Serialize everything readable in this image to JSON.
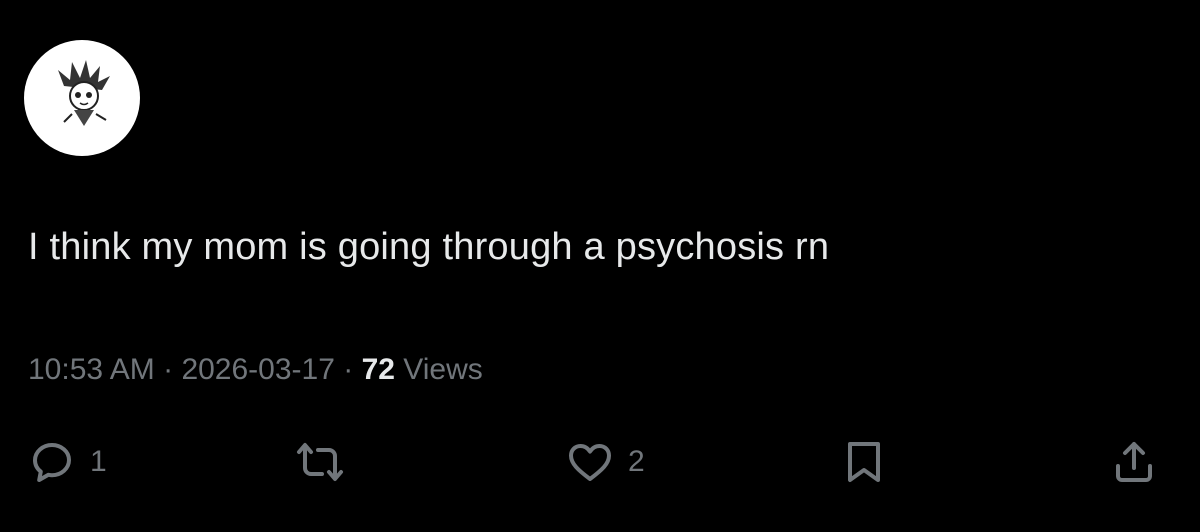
{
  "tweet": {
    "text": "I think my mom is going through a psychosis rn",
    "time": "10:53 AM",
    "separator_1": " · ",
    "date": "2026-03-17",
    "separator_2": " · ",
    "views_count": "72",
    "views_label": " Views"
  },
  "actions": {
    "reply_count": "1",
    "like_count": "2",
    "icons": [
      "reply-icon",
      "retweet-icon",
      "like-icon",
      "bookmark-icon",
      "share-icon"
    ]
  },
  "colors": {
    "background": "#000000",
    "primary_text": "#e7e9ea",
    "secondary_text": "#71767b",
    "avatar_bg": "#ffffff"
  }
}
